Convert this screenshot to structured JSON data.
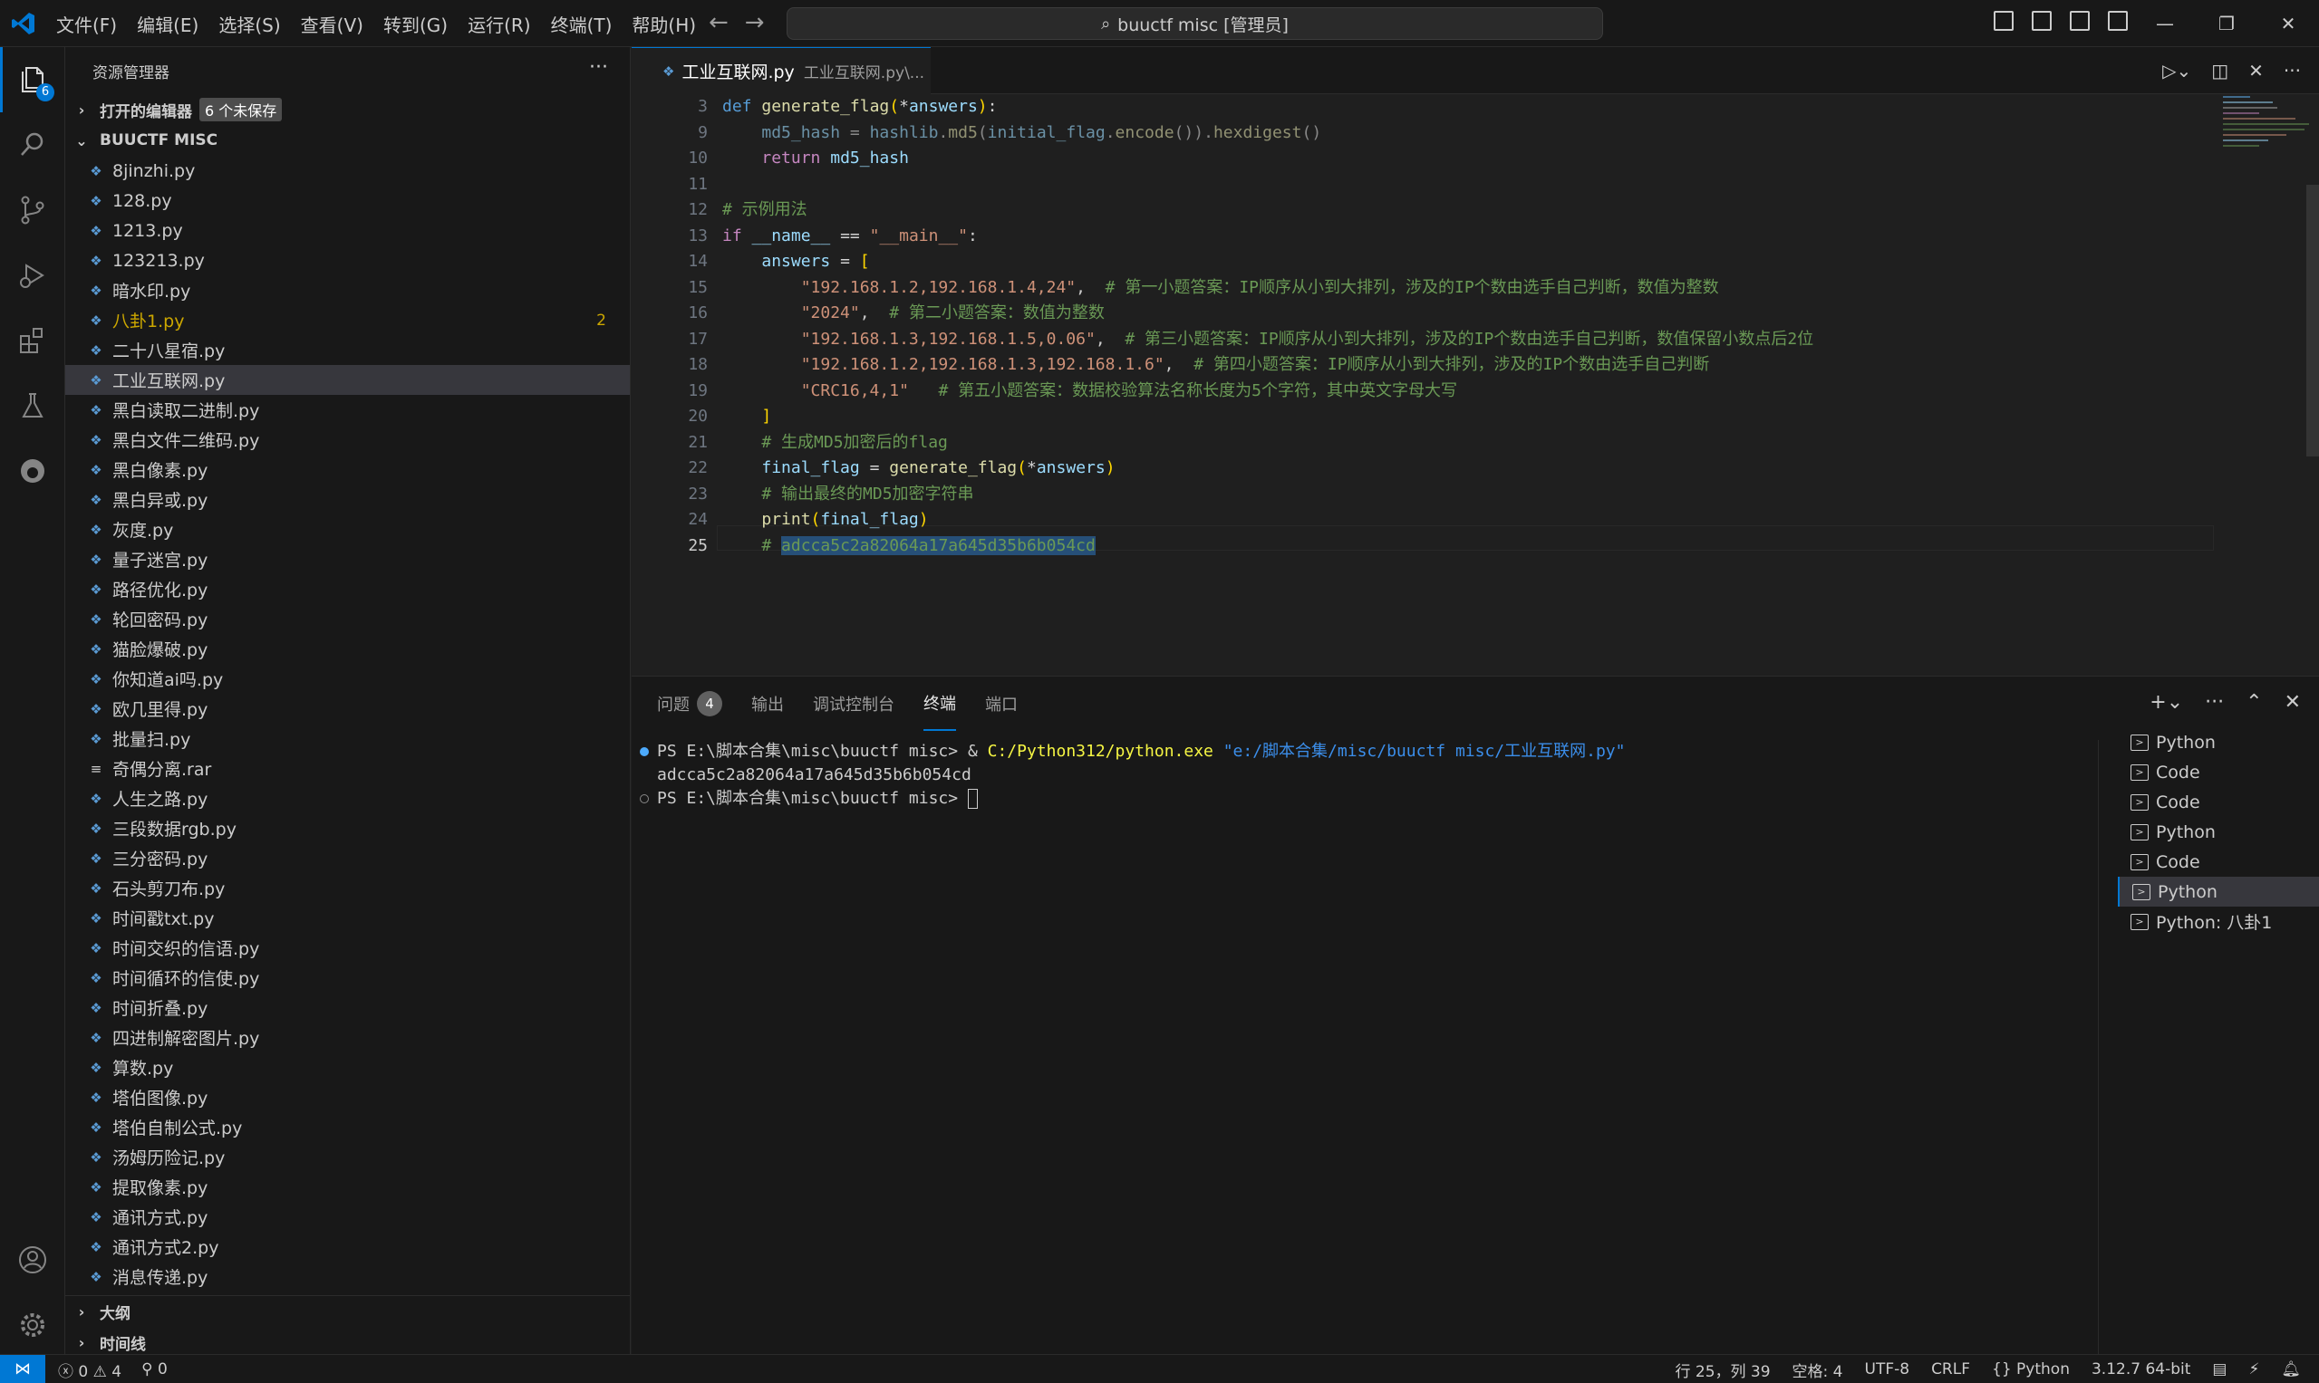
{
  "window": {
    "menu": [
      "文件(F)",
      "编辑(E)",
      "选择(S)",
      "查看(V)",
      "转到(G)",
      "运行(R)",
      "终端(T)",
      "帮助(H)"
    ],
    "command_center": "buuctf misc [管理员]"
  },
  "activity": {
    "explorer_badge": "6"
  },
  "sidebar": {
    "title": "资源管理器",
    "open_editors": "打开的编辑器",
    "unsaved_badge": "6 个未保存",
    "folder": "BUUCTF MISC",
    "files": [
      {
        "name": "8jinzhi.py"
      },
      {
        "name": "128.py"
      },
      {
        "name": "1213.py"
      },
      {
        "name": "123213.py"
      },
      {
        "name": "暗水印.py"
      },
      {
        "name": "八卦1.py",
        "count": "2"
      },
      {
        "name": "二十八星宿.py"
      },
      {
        "name": "工业互联网.py"
      },
      {
        "name": "黑白读取二进制.py"
      },
      {
        "name": "黑白文件二维码.py"
      },
      {
        "name": "黑白像素.py"
      },
      {
        "name": "黑白异或.py"
      },
      {
        "name": "灰度.py"
      },
      {
        "name": "量子迷宫.py"
      },
      {
        "name": "路径优化.py"
      },
      {
        "name": "轮回密码.py"
      },
      {
        "name": "猫脸爆破.py"
      },
      {
        "name": "你知道ai吗.py"
      },
      {
        "name": "欧几里得.py"
      },
      {
        "name": "批量扫.py"
      },
      {
        "name": "奇偶分离.rar"
      },
      {
        "name": "人生之路.py"
      },
      {
        "name": "三段数据rgb.py"
      },
      {
        "name": "三分密码.py"
      },
      {
        "name": "石头剪刀布.py"
      },
      {
        "name": "时间戳txt.py"
      },
      {
        "name": "时间交织的信语.py"
      },
      {
        "name": "时间循环的信使.py"
      },
      {
        "name": "时间折叠.py"
      },
      {
        "name": "四进制解密图片.py"
      },
      {
        "name": "算数.py"
      },
      {
        "name": "塔伯图像.py"
      },
      {
        "name": "塔伯自制公式.py"
      },
      {
        "name": "汤姆历险记.py"
      },
      {
        "name": "提取像素.py"
      },
      {
        "name": "通讯方式.py"
      },
      {
        "name": "通讯方式2.py"
      },
      {
        "name": "消息传递.py"
      }
    ],
    "outline": "大纲",
    "timeline": "时间线"
  },
  "editor": {
    "tab_name": "工业互联网.py",
    "tab_desc": "工业互联网.py\\...",
    "line_numbers": [
      "3",
      "9",
      "10",
      "11",
      "12",
      "13",
      "14",
      "15",
      "16",
      "17",
      "18",
      "19",
      "20",
      "21",
      "22",
      "23",
      "24",
      "25"
    ]
  },
  "panel": {
    "tabs": [
      "问题",
      "输出",
      "调试控制台",
      "终端",
      "端口"
    ],
    "problems_count": "4",
    "terminal_lines": [
      "PS E:\\脚本合集\\misc\\buuctf misc> ",
      "& ",
      "C:/Python312/python.exe",
      " \"e:/脚本合集/misc/buuctf misc/工业互联网.py\"",
      "adcca5c2a82064a17a645d35b6b054cd",
      "PS E:\\脚本合集\\misc\\buuctf misc> "
    ],
    "terminal_list": [
      "Python",
      "Code",
      "Code",
      "Python",
      "Code",
      "Python",
      "Python: 八卦1"
    ]
  },
  "status": {
    "errors": "0",
    "warnings": "4",
    "ports": "0",
    "position": "行 25，列 39",
    "spaces": "空格: 4",
    "encoding": "UTF-8",
    "eol": "CRLF",
    "language": "Python",
    "interpreter": "3.12.7 64-bit"
  }
}
